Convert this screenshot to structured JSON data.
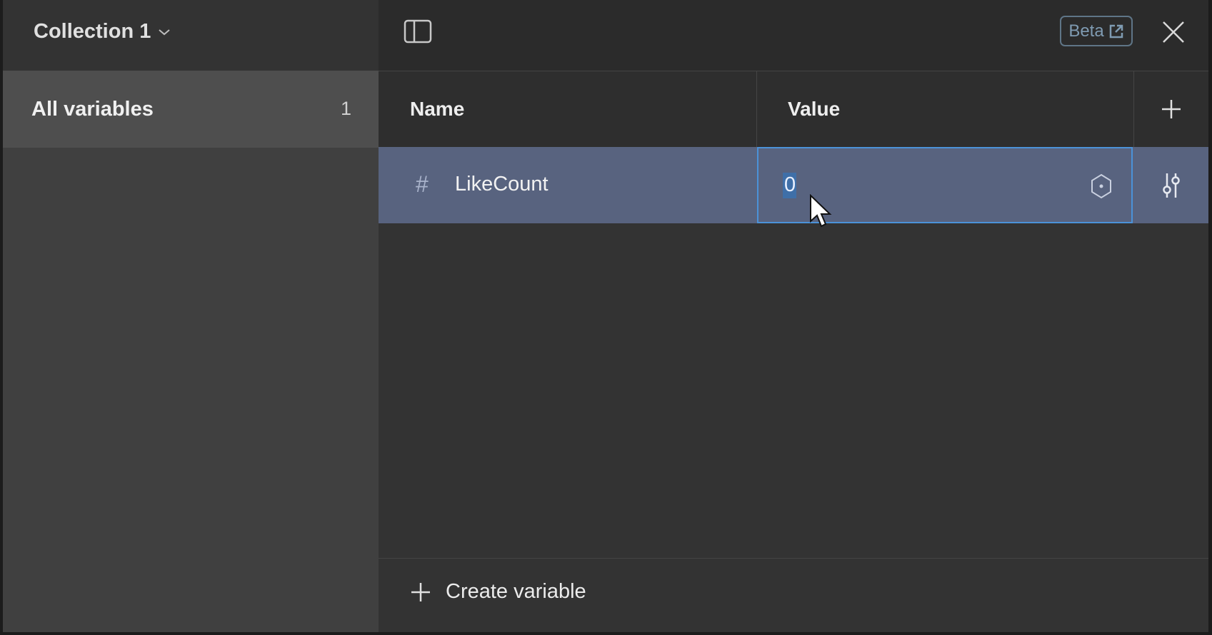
{
  "sidebar": {
    "collection_title": "Collection 1",
    "items": [
      {
        "label": "All variables",
        "count": "1",
        "selected": true
      }
    ]
  },
  "toolbar": {
    "beta_label": "Beta",
    "icons": [
      "sidebar-toggle-icon",
      "external-link-icon",
      "close-icon"
    ]
  },
  "table": {
    "columns": [
      "Name",
      "Value"
    ],
    "rows": [
      {
        "type_icon": "#",
        "name": "LikeCount",
        "value": "0",
        "selected": true,
        "editing": true
      }
    ]
  },
  "footer": {
    "create_label": "Create variable"
  },
  "colors": {
    "selected_row": "#58637f",
    "focus_border": "#4b92d8",
    "beta_accent": "#7f9bb2"
  }
}
